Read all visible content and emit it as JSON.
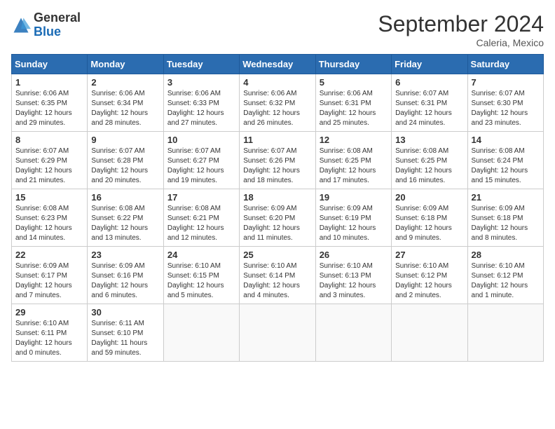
{
  "header": {
    "logo_general": "General",
    "logo_blue": "Blue",
    "month_year": "September 2024",
    "location": "Caleria, Mexico"
  },
  "weekdays": [
    "Sunday",
    "Monday",
    "Tuesday",
    "Wednesday",
    "Thursday",
    "Friday",
    "Saturday"
  ],
  "weeks": [
    [
      {
        "day": "1",
        "sunrise": "6:06 AM",
        "sunset": "6:35 PM",
        "daylight": "12 hours and 29 minutes."
      },
      {
        "day": "2",
        "sunrise": "6:06 AM",
        "sunset": "6:34 PM",
        "daylight": "12 hours and 28 minutes."
      },
      {
        "day": "3",
        "sunrise": "6:06 AM",
        "sunset": "6:33 PM",
        "daylight": "12 hours and 27 minutes."
      },
      {
        "day": "4",
        "sunrise": "6:06 AM",
        "sunset": "6:32 PM",
        "daylight": "12 hours and 26 minutes."
      },
      {
        "day": "5",
        "sunrise": "6:06 AM",
        "sunset": "6:31 PM",
        "daylight": "12 hours and 25 minutes."
      },
      {
        "day": "6",
        "sunrise": "6:07 AM",
        "sunset": "6:31 PM",
        "daylight": "12 hours and 24 minutes."
      },
      {
        "day": "7",
        "sunrise": "6:07 AM",
        "sunset": "6:30 PM",
        "daylight": "12 hours and 23 minutes."
      }
    ],
    [
      {
        "day": "8",
        "sunrise": "6:07 AM",
        "sunset": "6:29 PM",
        "daylight": "12 hours and 21 minutes."
      },
      {
        "day": "9",
        "sunrise": "6:07 AM",
        "sunset": "6:28 PM",
        "daylight": "12 hours and 20 minutes."
      },
      {
        "day": "10",
        "sunrise": "6:07 AM",
        "sunset": "6:27 PM",
        "daylight": "12 hours and 19 minutes."
      },
      {
        "day": "11",
        "sunrise": "6:07 AM",
        "sunset": "6:26 PM",
        "daylight": "12 hours and 18 minutes."
      },
      {
        "day": "12",
        "sunrise": "6:08 AM",
        "sunset": "6:25 PM",
        "daylight": "12 hours and 17 minutes."
      },
      {
        "day": "13",
        "sunrise": "6:08 AM",
        "sunset": "6:25 PM",
        "daylight": "12 hours and 16 minutes."
      },
      {
        "day": "14",
        "sunrise": "6:08 AM",
        "sunset": "6:24 PM",
        "daylight": "12 hours and 15 minutes."
      }
    ],
    [
      {
        "day": "15",
        "sunrise": "6:08 AM",
        "sunset": "6:23 PM",
        "daylight": "12 hours and 14 minutes."
      },
      {
        "day": "16",
        "sunrise": "6:08 AM",
        "sunset": "6:22 PM",
        "daylight": "12 hours and 13 minutes."
      },
      {
        "day": "17",
        "sunrise": "6:08 AM",
        "sunset": "6:21 PM",
        "daylight": "12 hours and 12 minutes."
      },
      {
        "day": "18",
        "sunrise": "6:09 AM",
        "sunset": "6:20 PM",
        "daylight": "12 hours and 11 minutes."
      },
      {
        "day": "19",
        "sunrise": "6:09 AM",
        "sunset": "6:19 PM",
        "daylight": "12 hours and 10 minutes."
      },
      {
        "day": "20",
        "sunrise": "6:09 AM",
        "sunset": "6:18 PM",
        "daylight": "12 hours and 9 minutes."
      },
      {
        "day": "21",
        "sunrise": "6:09 AM",
        "sunset": "6:18 PM",
        "daylight": "12 hours and 8 minutes."
      }
    ],
    [
      {
        "day": "22",
        "sunrise": "6:09 AM",
        "sunset": "6:17 PM",
        "daylight": "12 hours and 7 minutes."
      },
      {
        "day": "23",
        "sunrise": "6:09 AM",
        "sunset": "6:16 PM",
        "daylight": "12 hours and 6 minutes."
      },
      {
        "day": "24",
        "sunrise": "6:10 AM",
        "sunset": "6:15 PM",
        "daylight": "12 hours and 5 minutes."
      },
      {
        "day": "25",
        "sunrise": "6:10 AM",
        "sunset": "6:14 PM",
        "daylight": "12 hours and 4 minutes."
      },
      {
        "day": "26",
        "sunrise": "6:10 AM",
        "sunset": "6:13 PM",
        "daylight": "12 hours and 3 minutes."
      },
      {
        "day": "27",
        "sunrise": "6:10 AM",
        "sunset": "6:12 PM",
        "daylight": "12 hours and 2 minutes."
      },
      {
        "day": "28",
        "sunrise": "6:10 AM",
        "sunset": "6:12 PM",
        "daylight": "12 hours and 1 minute."
      }
    ],
    [
      {
        "day": "29",
        "sunrise": "6:10 AM",
        "sunset": "6:11 PM",
        "daylight": "12 hours and 0 minutes."
      },
      {
        "day": "30",
        "sunrise": "6:11 AM",
        "sunset": "6:10 PM",
        "daylight": "11 hours and 59 minutes."
      },
      null,
      null,
      null,
      null,
      null
    ]
  ]
}
